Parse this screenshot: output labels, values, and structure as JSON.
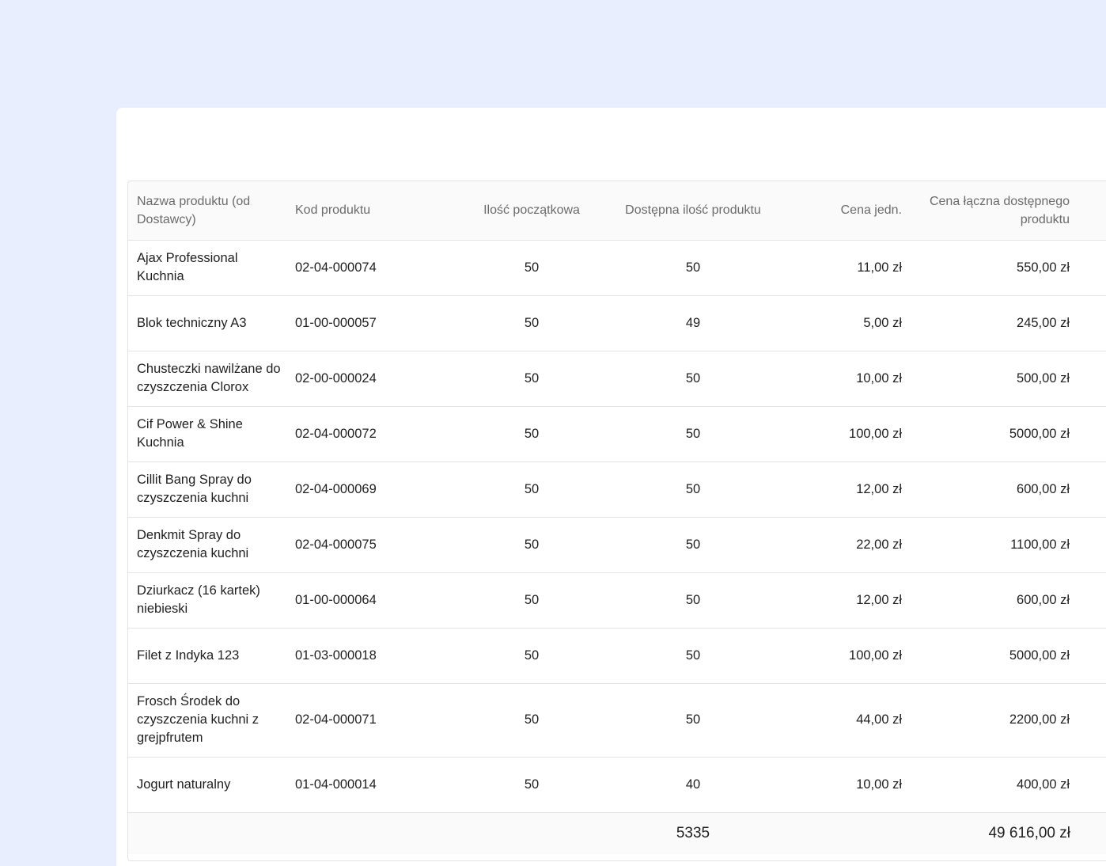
{
  "table": {
    "headers": {
      "name": "Nazwa produktu (od Dostawcy)",
      "code": "Kod produktu",
      "initial_qty": "Ilość początkowa",
      "available_qty": "Dostępna ilość produktu",
      "unit_price": "Cena jedn.",
      "total_price": "Cena łączna dostępnego produktu"
    },
    "rows": [
      {
        "name": "Ajax Professional Kuchnia",
        "code": "02-04-000074",
        "initial_qty": "50",
        "available_qty": "50",
        "unit_price": "11,00 zł",
        "total_price": "550,00 zł"
      },
      {
        "name": "Blok techniczny A3",
        "code": "01-00-000057",
        "initial_qty": "50",
        "available_qty": "49",
        "unit_price": "5,00 zł",
        "total_price": "245,00 zł"
      },
      {
        "name": "Chusteczki nawilżane do czyszczenia Clorox",
        "code": "02-00-000024",
        "initial_qty": "50",
        "available_qty": "50",
        "unit_price": "10,00 zł",
        "total_price": "500,00 zł"
      },
      {
        "name": "Cif Power & Shine Kuchnia",
        "code": "02-04-000072",
        "initial_qty": "50",
        "available_qty": "50",
        "unit_price": "100,00 zł",
        "total_price": "5000,00 zł"
      },
      {
        "name": "Cillit Bang Spray do czyszczenia kuchni",
        "code": "02-04-000069",
        "initial_qty": "50",
        "available_qty": "50",
        "unit_price": "12,00 zł",
        "total_price": "600,00 zł"
      },
      {
        "name": "Denkmit Spray do czyszczenia kuchni",
        "code": "02-04-000075",
        "initial_qty": "50",
        "available_qty": "50",
        "unit_price": "22,00 zł",
        "total_price": "1100,00 zł"
      },
      {
        "name": "Dziurkacz (16 kartek) niebieski",
        "code": "01-00-000064",
        "initial_qty": "50",
        "available_qty": "50",
        "unit_price": "12,00 zł",
        "total_price": "600,00 zł"
      },
      {
        "name": "Filet z Indyka 123",
        "code": "01-03-000018",
        "initial_qty": "50",
        "available_qty": "50",
        "unit_price": "100,00 zł",
        "total_price": "5000,00 zł"
      },
      {
        "name": "Frosch Środek do czyszczenia kuchni z grejpfrutem",
        "code": "02-04-000071",
        "initial_qty": "50",
        "available_qty": "50",
        "unit_price": "44,00 zł",
        "total_price": "2200,00 zł"
      },
      {
        "name": "Jogurt naturalny",
        "code": "01-04-000014",
        "initial_qty": "50",
        "available_qty": "40",
        "unit_price": "10,00 zł",
        "total_price": "400,00 zł"
      }
    ],
    "footer": {
      "available_qty_sum": "5335",
      "total_price_sum": "49 616,00 zł"
    }
  }
}
